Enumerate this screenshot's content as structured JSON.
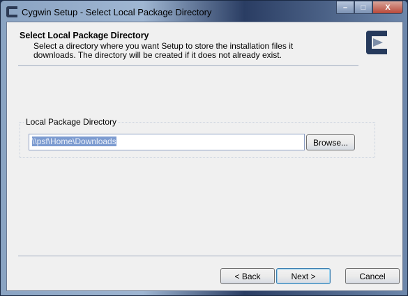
{
  "window": {
    "title": "Cygwin Setup - Select Local Package Directory",
    "controls": {
      "minimize": "–",
      "maximize": "□",
      "close": "X"
    }
  },
  "header": {
    "title": "Select Local Package Directory",
    "description": "Select a directory where you want Setup to store the installation files it downloads.  The directory will be created if it does not already exist."
  },
  "group": {
    "label": "Local Package Directory",
    "path_value": "\\\\psf\\Home\\Downloads",
    "browse_label": "Browse..."
  },
  "footer": {
    "back_label": "< Back",
    "next_label": "Next >",
    "cancel_label": "Cancel"
  }
}
